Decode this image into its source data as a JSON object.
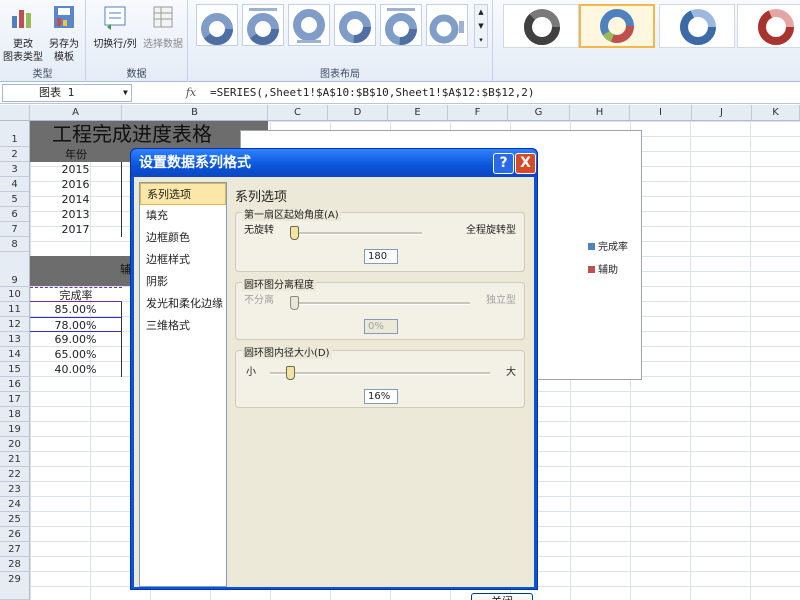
{
  "ribbon": {
    "change_type_label": "更改\n图表类型",
    "save_template_label": "另存为\n模板",
    "group_type": "类型",
    "switch_label": "切换行/列",
    "select_data_label": "选择数据",
    "group_data": "数据",
    "group_layout": "图表布局"
  },
  "formula_bar": {
    "name_box": "图表 1",
    "fx": "fx",
    "formula": "=SERIES(,Sheet1!$A$10:$B$10,Sheet1!$A$12:$B$12,2)"
  },
  "columns": [
    "A",
    "B",
    "C",
    "D",
    "E",
    "F",
    "G",
    "H",
    "I",
    "J",
    "K"
  ],
  "rows": [
    "1",
    "2",
    "3",
    "4",
    "5",
    "6",
    "7",
    "8",
    "9",
    "10",
    "11",
    "12",
    "13",
    "14",
    "15",
    "16",
    "17",
    "18",
    "19",
    "20",
    "21",
    "22",
    "23",
    "24",
    "25",
    "26",
    "27",
    "28",
    "29"
  ],
  "sheet": {
    "title": "工程完成进度表格",
    "year_header": "年份",
    "years": [
      "2015",
      "2016",
      "2014",
      "2013",
      "2017"
    ],
    "row9_partial": "辅",
    "rate_header": "完成率",
    "rates": [
      "85.00%",
      "78.00%",
      "69.00%",
      "65.00%",
      "40.00%"
    ]
  },
  "legend": {
    "items": [
      {
        "label": "完成率",
        "color": "#4f81bd"
      },
      {
        "label": "辅助",
        "color": "#c0504d"
      }
    ]
  },
  "dialog": {
    "title": "设置数据系列格式",
    "help": "?",
    "close_x": "X",
    "categories": [
      "系列选项",
      "填充",
      "边框颜色",
      "边框样式",
      "阴影",
      "发光和柔化边缘",
      "三维格式"
    ],
    "selected_category": "系列选项",
    "panel_title": "系列选项",
    "angle": {
      "legend": "第一扇区起始角度(A)",
      "min_label": "无旋转",
      "max_label": "全程旋转型",
      "value": "180"
    },
    "explosion": {
      "legend": "圆环图分离程度",
      "min_label": "不分离",
      "max_label": "独立型",
      "value": "0%"
    },
    "hole": {
      "legend": "圆环图内径大小(D)",
      "min_label": "小",
      "max_label": "大",
      "value": "16%"
    },
    "close_button": "关闭"
  },
  "colors": {
    "title_bar": "#0a54d9",
    "series_blue": "#4f81bd",
    "series_red": "#c0504d",
    "series_green": "#9bbb59"
  }
}
